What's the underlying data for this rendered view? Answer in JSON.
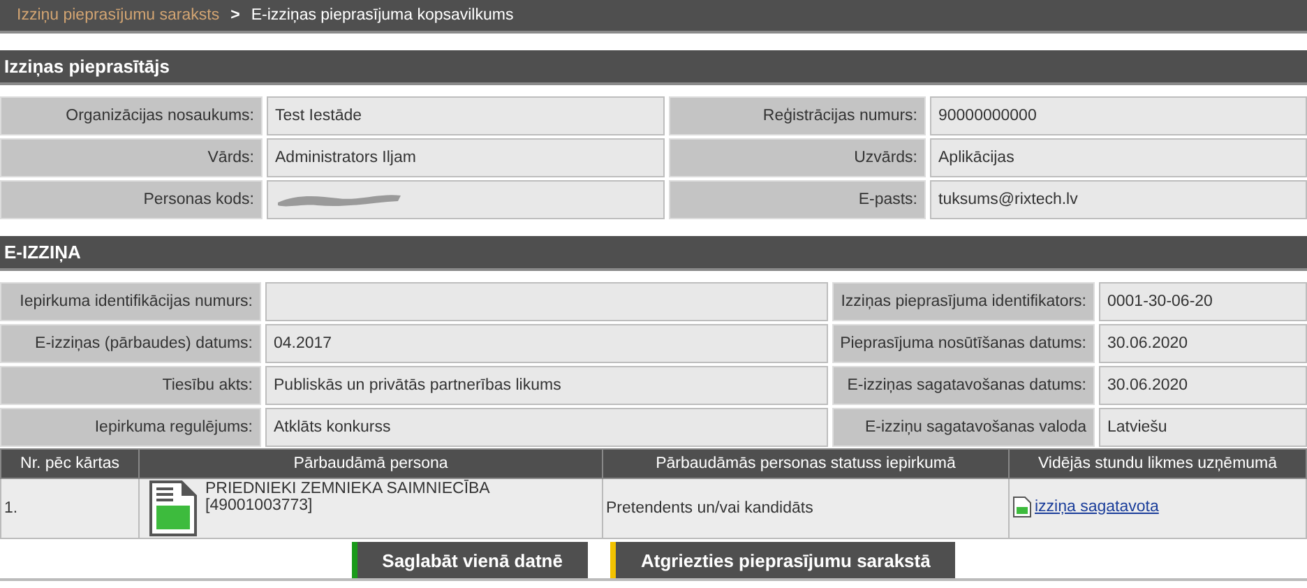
{
  "breadcrumb": {
    "items": [
      {
        "label": "Izziņu pieprasījumu saraksts",
        "kind": "link"
      },
      {
        "label": ">",
        "kind": "separator"
      },
      {
        "label": "E-izziņas pieprasījuma kopsavilkums",
        "kind": "current"
      }
    ]
  },
  "requester": {
    "title": "Izziņas pieprasītājs",
    "rows": [
      {
        "left": {
          "label": "Organizācijas nosaukums:",
          "value": "Test Iestāde"
        },
        "right": {
          "label": "Reģistrācijas numurs:",
          "value": "90000000000"
        }
      },
      {
        "left": {
          "label": "Vārds:",
          "value": "Administrators Iljam"
        },
        "right": {
          "label": "Uzvārds:",
          "value": "Aplikācijas"
        }
      },
      {
        "left": {
          "label": "Personas kods:",
          "redacted": true
        },
        "right": {
          "label": "E-pasts:",
          "value": "tuksums@rixtech.lv"
        }
      }
    ]
  },
  "certificate": {
    "title": "E-IZZIŅA",
    "rows": [
      {
        "left": {
          "label": "Iepirkuma identifikācijas numurs:"
        },
        "right": {
          "label": "Izziņas pieprasījuma identifikators:",
          "value": "0001-30-06-20"
        }
      },
      {
        "left": {
          "label": "E-izziņas (pārbaudes) datums:",
          "value": "04.2017"
        },
        "right": {
          "label": "Pieprasījuma nosūtīšanas datums:",
          "value": "30.06.2020"
        }
      },
      {
        "left": {
          "label": "Tiesību akts:",
          "value": "Publiskās un privātās partnerības likums"
        },
        "right": {
          "label": "E-izziņas sagatavošanas datums:",
          "value": "30.06.2020"
        }
      },
      {
        "left": {
          "label": "Iepirkuma regulējums:",
          "value": "Atklāts konkurss"
        },
        "right": {
          "label": "E-izziņu sagatavošanas valoda",
          "value": "Latviešu"
        }
      }
    ]
  },
  "table": {
    "columns": [
      "Nr. pēc kārtas",
      "Pārbaudāmā persona",
      "Pārbaudāmās personas statuss iepirkumā",
      "Vidējās stundu likmes uzņēmumā"
    ],
    "rows": [
      {
        "number": "1.",
        "person_name": "PRIEDNIEKI ZEMNIEKA SAIMNIECĪBA",
        "person_code": "[49001003773]",
        "status": "Pretendents un/vai kandidāts",
        "document_link": "izziņa sagatavota"
      }
    ]
  },
  "buttons": [
    {
      "label": "Saglabāt vienā datnē",
      "color": "#1a9a1a"
    },
    {
      "label": "Atgriezties pieprasījumu sarakstā",
      "color": "#f2c200"
    }
  ]
}
